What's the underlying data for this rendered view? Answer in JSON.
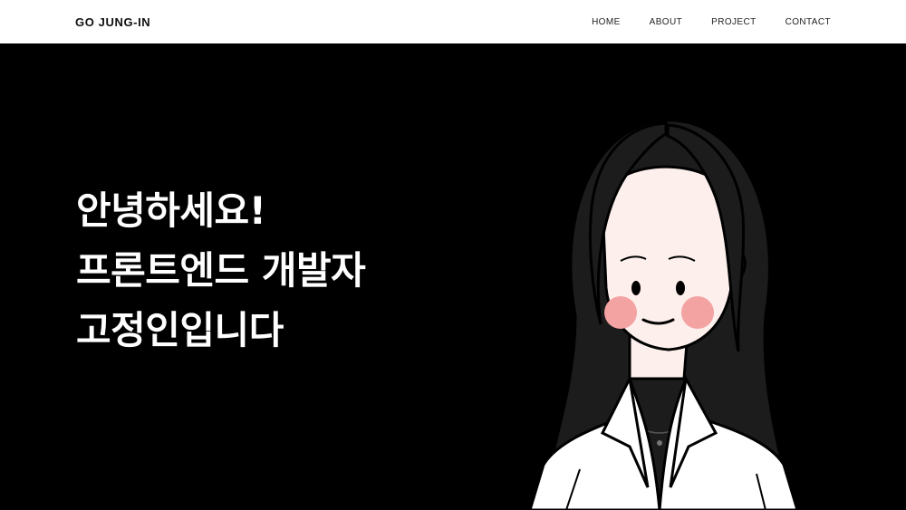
{
  "nav": {
    "brand": "GO JUNG-IN",
    "links": [
      "HOME",
      "ABOUT",
      "PROJECT",
      "CONTACT"
    ]
  },
  "hero": {
    "lines": [
      "안녕하세요!",
      "프론트엔드 개발자",
      "고정인입니다"
    ]
  },
  "colors": {
    "nav_bg": "#ffffff",
    "hero_bg": "#000000",
    "hero_text": "#ffffff",
    "skin": "#fcefec",
    "hair": "#1c1c1c",
    "blush": "#f4a3a3",
    "shirt": "#ffffff"
  },
  "illustration": {
    "name": "character-portrait-illustration"
  }
}
